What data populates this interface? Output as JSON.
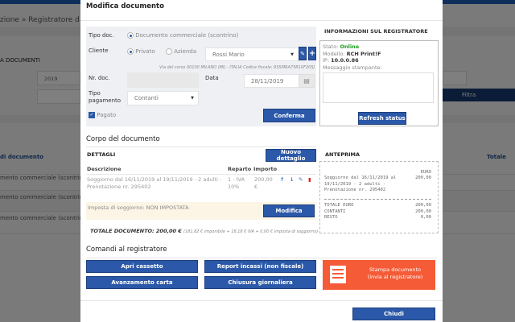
{
  "background": {
    "breadcrumb": "zione  »  Registratore d",
    "section_title": "A DOCUMENTI",
    "year_value": "2019",
    "filter_button": "Filtra",
    "col_tipo": "di documento",
    "col_totale": "Totale",
    "rows": [
      "mento commerciale (scontrino)",
      "mento commerciale (scontrino)",
      "mento commerciale (scontrino)"
    ]
  },
  "modal": {
    "title": "Modifica documento",
    "form": {
      "tipo_doc_label": "Tipo doc.",
      "tipo_doc_option": "Documento commerciale (scontrino)",
      "cliente_label": "Cliente",
      "privato": "Privato",
      "azienda": "Azienda",
      "cliente_value": "Rossi Mario",
      "cliente_address": "Via del corso 00100 MILANO (MI) - ITALIA Codice fiscale: RSSMRA75R10F205J",
      "nr_doc_label": "Nr. doc.",
      "nr_doc_value": "",
      "data_label": "Data",
      "data_value": "28/11/2019",
      "tipo_pagamento_label": "Tipo pagamento",
      "tipo_pagamento_value": "Contanti",
      "pagato_label": "Pagato",
      "pagato_checked": true,
      "confirm_button": "Conferma"
    },
    "registratore": {
      "title": "INFORMAZIONI SUL REGISTRATORE",
      "stato_label": "Stato:",
      "stato_value": "Online",
      "modello_label": "Modello:",
      "modello_value": "RCH Print!F",
      "ip_label": "IP:",
      "ip_value": "10.0.0.86",
      "messaggio_label": "Messaggio stampante:",
      "messaggio_value": "",
      "refresh_button": "Refresh status"
    },
    "corpo": {
      "title": "Corpo del documento",
      "dettagli_title": "DETTAGLI",
      "nuovo_button": "Nuovo dettaglio",
      "headers": [
        "Descrizione",
        "Reparto",
        "Importo"
      ],
      "rows": [
        {
          "descrizione": "Soggiorno dal 16/11/2019 al 19/11/2019 - 2 adulti - Prenotazione nr. 295402",
          "reparto": "1 - IVA 10%",
          "importo": "200,00 €"
        }
      ],
      "imposta_text": "Imposta di soggiorno: NON IMPOSTATA",
      "modifica_button": "Modifica",
      "totale_label": "TOTALE DOCUMENTO: 200,00 €",
      "totale_detail": "(181,82 € imponibile + 18,18 € IVA + 0,00 € imposta di soggiorno)"
    },
    "anteprima": {
      "title": "ANTEPRIMA",
      "currency": "EURO",
      "item_desc": [
        "Soggiorno dal 16/11/2019 al",
        "19/11/2019 - 2 adulti -",
        "Prenotazione nr. 295402"
      ],
      "item_amount": "200,00",
      "totals": [
        {
          "label": "TOTALE EURO",
          "value": "200,00"
        },
        {
          "label": "CONTANTI",
          "value": "200,00"
        },
        {
          "label": "RESTO",
          "value": "0,00"
        }
      ]
    },
    "comandi": {
      "title": "Comandi al registratore",
      "apri_cassetto": "Apri cassetto",
      "report_incassi": "Report incassi (non fiscale)",
      "avanzamento_carta": "Avanzamento carta",
      "chiusura_giornaliera": "Chiusura giornaliera",
      "stampa_line1": "Stampa documento",
      "stampa_line2": "(invia al registratore)"
    },
    "close_button": "Chiudi"
  },
  "colors": {
    "primary": "#2b58a8",
    "orange": "#f45b36",
    "online": "#1a9a1a",
    "danger": "#e02020",
    "warning_bg": "#fcf5e6"
  }
}
